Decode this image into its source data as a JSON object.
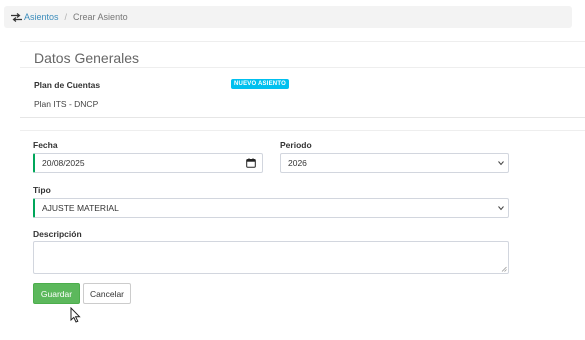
{
  "breadcrumb": {
    "icon": "exchange-arrows-icon",
    "parent_label": "Asientos",
    "separator": "/",
    "current_label": "Crear Asiento"
  },
  "section": {
    "title": "Datos Generales"
  },
  "plan": {
    "label": "Plan de Cuentas",
    "value": "Plan ITS - DNCP",
    "badge": "NUEVO ASIENTO"
  },
  "form": {
    "fecha": {
      "label": "Fecha",
      "value": "20/08/2025",
      "icon": "calendar-icon"
    },
    "periodo": {
      "label": "Periodo",
      "value": "2026"
    },
    "tipo": {
      "label": "Tipo",
      "value": "AJUSTE MATERIAL"
    },
    "descripcion": {
      "label": "Descripción",
      "value": ""
    }
  },
  "actions": {
    "save_label": "Guardar",
    "cancel_label": "Cancelar"
  },
  "colors": {
    "accent": "#3c8dbc",
    "badge": "#00c0ef",
    "required_border": "#00a65a",
    "save_button": "#5cb85c"
  }
}
